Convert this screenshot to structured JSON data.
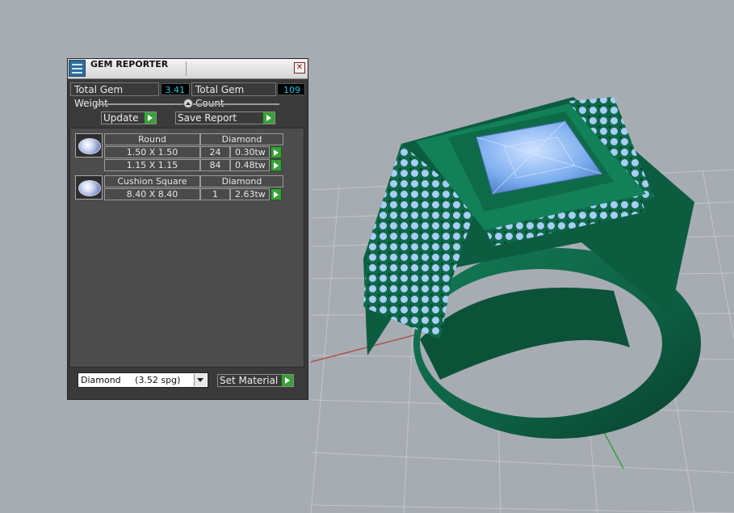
{
  "panel": {
    "title": "GEM REPORTER",
    "close_glyph": "✕",
    "total_weight_label": "Total Gem Weight",
    "total_weight_value": "3.41",
    "total_count_label": "Total Gem Count",
    "total_count_value": "109",
    "update_label": "Update",
    "save_report_label": "Save Report",
    "gem_groups": [
      {
        "shape": "Round",
        "material": "Diamond",
        "rows": [
          {
            "size": "1.50 X 1.50",
            "count": "24",
            "weight": "0.30tw"
          },
          {
            "size": "1.15 X 1.15",
            "count": "84",
            "weight": "0.48tw"
          }
        ]
      },
      {
        "shape": "Cushion Square",
        "material": "Diamond",
        "rows": [
          {
            "size": "8.40 X 8.40",
            "count": "1",
            "weight": "2.63tw"
          }
        ]
      }
    ],
    "material_select_value": "Diamond     (3.52 spg)",
    "set_material_label": "Set Material"
  },
  "colors": {
    "viewport_bg": "#a6acb2",
    "ring_metal": "#0f6a4a",
    "gem_blue": "#7fb0f0",
    "value_cyan": "#19c6e6",
    "accent_green": "#3aa03a"
  }
}
